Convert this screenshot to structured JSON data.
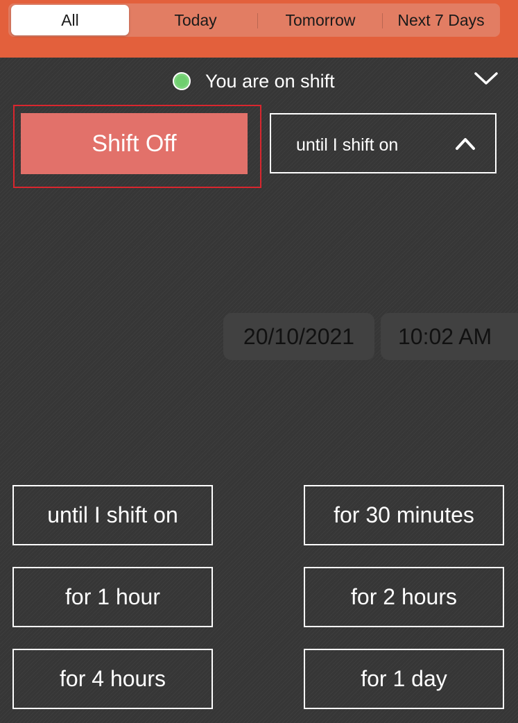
{
  "tabs": {
    "items": [
      {
        "label": "All",
        "active": true
      },
      {
        "label": "Today",
        "active": false
      },
      {
        "label": "Tomorrow",
        "active": false
      },
      {
        "label": "Next 7 Days",
        "active": false
      }
    ]
  },
  "status": {
    "text": "You are on shift",
    "indicator_color": "#6fcf6f"
  },
  "shift_button": {
    "label": "Shift Off",
    "color": "#e2716a"
  },
  "duration_select": {
    "value": "until I shift on",
    "icon": "chevron-up-icon"
  },
  "datetime": {
    "date": "20/10/2021",
    "time": "10:02 AM"
  },
  "options": [
    {
      "label": "until I shift on"
    },
    {
      "label": "for 30 minutes"
    },
    {
      "label": "for 1 hour"
    },
    {
      "label": "for 2 hours"
    },
    {
      "label": "for 4 hours"
    },
    {
      "label": "for 1 day"
    }
  ],
  "colors": {
    "header": "#e3603c",
    "segment_bg": "#e27d63",
    "background": "#363636",
    "highlight_border": "#d9262e"
  }
}
